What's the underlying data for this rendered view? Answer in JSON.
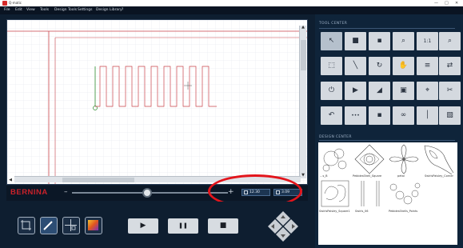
{
  "window": {
    "title": "Q-matic",
    "controls": [
      "—",
      "□",
      "✕"
    ]
  },
  "menu": [
    "File",
    "Edit",
    "View",
    "Tools",
    "Design Tools",
    "Settings",
    "Design Library",
    "?"
  ],
  "status": {
    "brand": "BERNINA",
    "zoom_minus": "–",
    "zoom_plus": "+",
    "zoom_level": 0.48,
    "readout_1": "12.30",
    "readout_2": "3.09"
  },
  "tool_center": {
    "title": "TOOL CENTER",
    "buttons": [
      {
        "name": "select-arrow-icon",
        "glyph": "↖"
      },
      {
        "name": "stop-square-icon",
        "glyph": "■"
      },
      {
        "name": "node-edit-icon",
        "glyph": "▪"
      },
      {
        "name": "zoom-icon",
        "glyph": "⌕"
      },
      {
        "name": "zoom-fit-icon",
        "glyph": "1:1"
      },
      {
        "name": "zoom-out-icon",
        "glyph": "⌕"
      },
      {
        "name": "move-icon",
        "glyph": "⬚"
      },
      {
        "name": "magic-wand-icon",
        "glyph": "╲"
      },
      {
        "name": "rotate-icon",
        "glyph": "↻"
      },
      {
        "name": "hand-icon",
        "glyph": "✋"
      },
      {
        "name": "align-icon",
        "glyph": "≡"
      },
      {
        "name": "flip-icon",
        "glyph": "⇄"
      },
      {
        "name": "power-icon",
        "glyph": "⏻"
      },
      {
        "name": "arrow-right-icon",
        "glyph": "▶"
      },
      {
        "name": "mirror-icon",
        "glyph": "◢"
      },
      {
        "name": "frame-icon",
        "glyph": "▣"
      },
      {
        "name": "crosshair-icon",
        "glyph": "⌖"
      },
      {
        "name": "scissors-icon",
        "glyph": "✂"
      },
      {
        "name": "undo-icon",
        "glyph": "↶"
      },
      {
        "name": "stitch-repeat-icon",
        "glyph": "•••"
      },
      {
        "name": "split-icon",
        "glyph": "▪"
      },
      {
        "name": "link-icon",
        "glyph": "∞"
      },
      {
        "name": "ruler-icon",
        "glyph": "│"
      },
      {
        "name": "export-icon",
        "glyph": "▧"
      }
    ]
  },
  "design_center": {
    "title": "DESIGN CENTER",
    "items": [
      "…s_B",
      "PebblesShell_Square",
      "petal",
      "SwirlsPaisley_Corner",
      "SwirlsPaisley_Square1",
      "Swirls_06",
      "PebblesShells_Points"
    ]
  },
  "playback": {
    "play_glyph": "▶",
    "pause_glyph": "❚❚",
    "stop_glyph": "■"
  },
  "colors": {
    "accent_red": "#e3141b",
    "panel_bg": "#0f243a",
    "canvas_bg": "#ffffff"
  }
}
